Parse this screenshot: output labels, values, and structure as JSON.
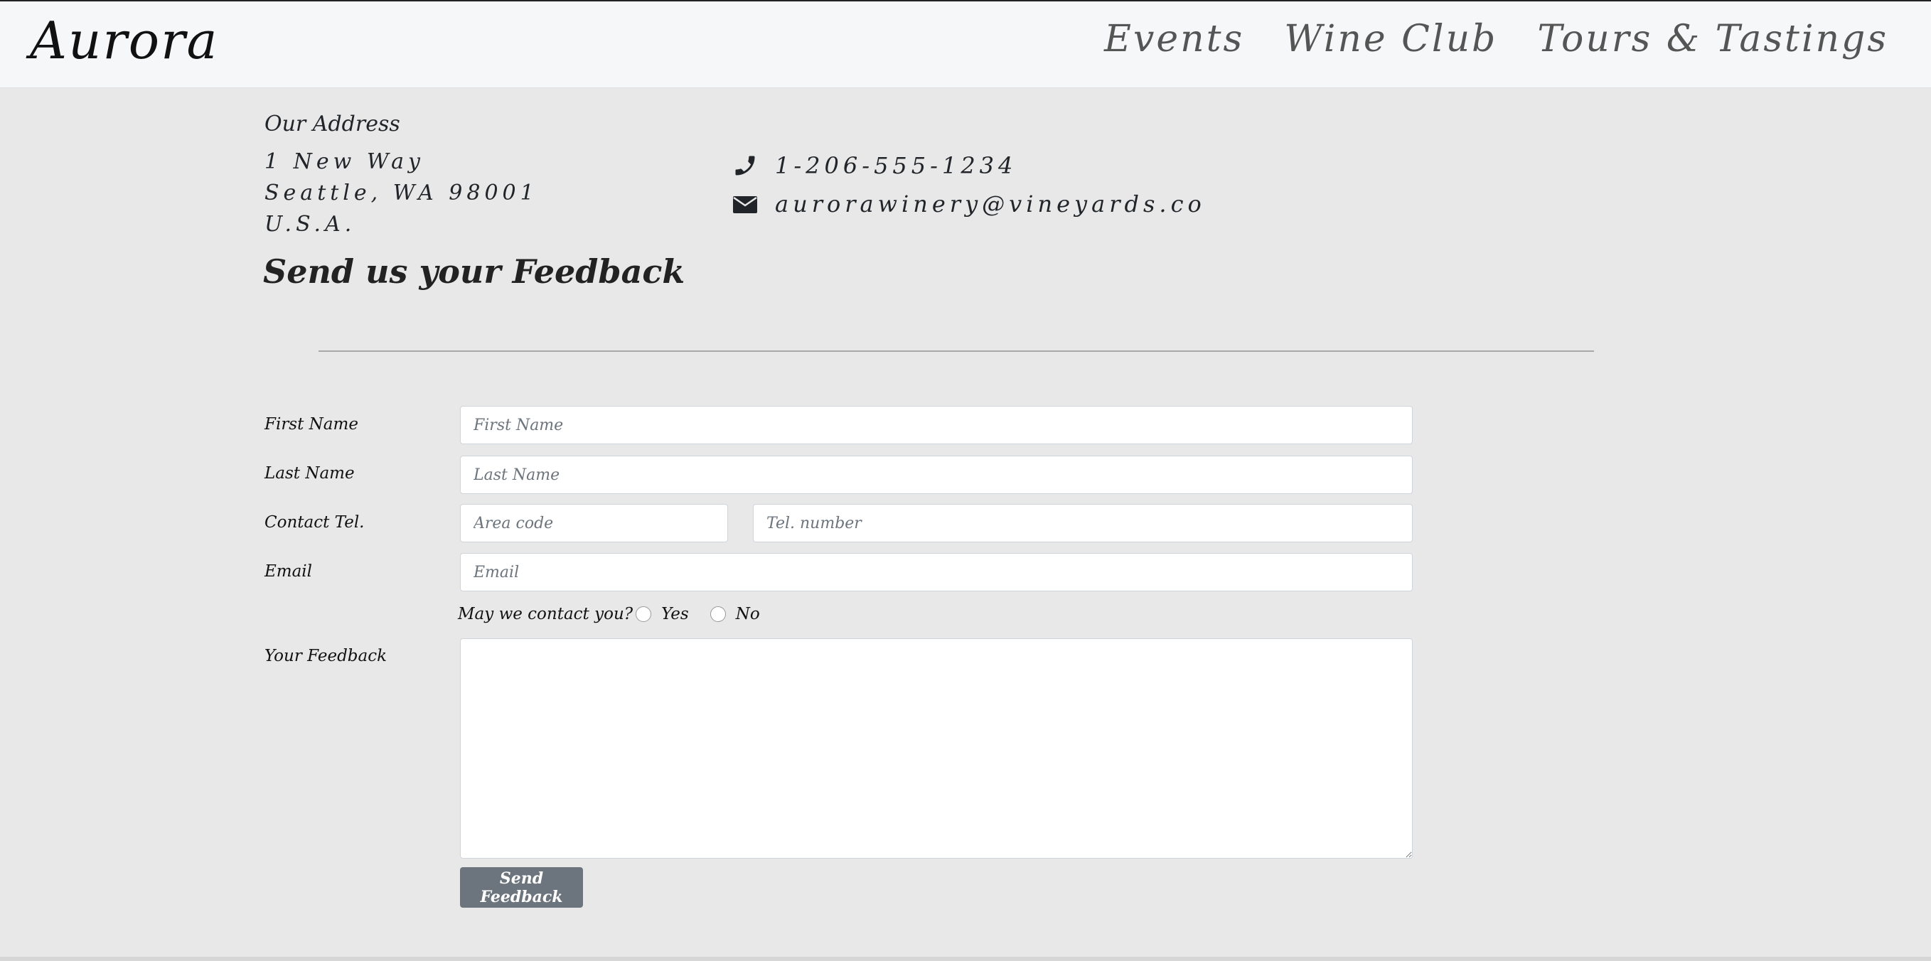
{
  "navbar": {
    "brand": "Aurora",
    "links": [
      "Events",
      "Wine Club",
      "Tours & Tastings"
    ]
  },
  "address": {
    "title": "Our Address",
    "lines": [
      "1 New Way",
      "Seattle, WA 98001",
      "U.S.A."
    ]
  },
  "contact": {
    "phone": "1-206-555-1234",
    "email": "aurorawinery@vineyards.co",
    "phone_icon": "phone-icon",
    "email_icon": "envelope-icon"
  },
  "feedback": {
    "title": "Send us your Feedback"
  },
  "form": {
    "first_name_label": "First Name",
    "first_name_placeholder": "First Name",
    "last_name_label": "Last Name",
    "last_name_placeholder": "Last Name",
    "tel_label": "Contact Tel.",
    "area_code_placeholder": "Area code",
    "tel_number_placeholder": "Tel. number",
    "email_label": "Email",
    "email_placeholder": "Email",
    "contact_question": "May we contact you?",
    "yes_label": "Yes",
    "no_label": "No",
    "feedback_label": "Your Feedback",
    "feedback_value": "",
    "submit_label": "Send Feedback"
  },
  "colors": {
    "page_background": "#e8e8e8",
    "navbar_background": "#f6f7f8",
    "button_background": "#6c757d"
  }
}
